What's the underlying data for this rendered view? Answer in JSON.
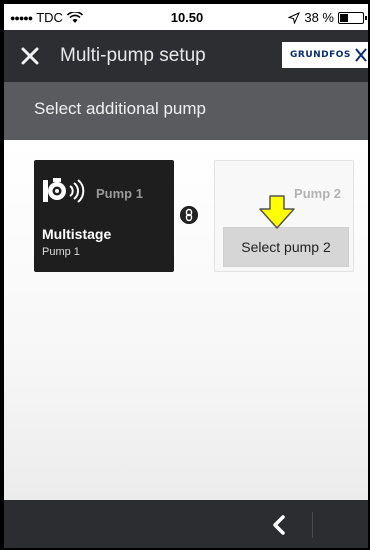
{
  "status_bar": {
    "signal_dots": "●●●●●",
    "carrier": "TDC",
    "time": "10.50",
    "battery_text": "38 %",
    "battery_level": 0.38
  },
  "header": {
    "title": "Multi-pump setup",
    "logo_text": "GRUNDFOS"
  },
  "sub_header": {
    "title": "Select additional pump"
  },
  "pump1": {
    "title": "Pump 1",
    "type": "Multistage",
    "name": "Pump 1"
  },
  "pump2": {
    "title": "Pump 2",
    "button_label": "Select pump 2"
  },
  "colors": {
    "header_bg": "#2c2e31",
    "sub_header_bg": "#595b5e",
    "pump_card_bg": "#1e1e1e",
    "arrow_yellow": "#ffff00",
    "brand_blue": "#0b2f6e"
  },
  "icons": [
    "wifi-icon",
    "location-arrow-icon",
    "battery-icon",
    "close-icon",
    "grundfos-x-icon",
    "pump-wireless-icon",
    "link-icon",
    "down-arrow-icon",
    "back-chevron-icon"
  ]
}
